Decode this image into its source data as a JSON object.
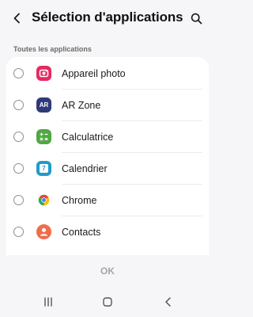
{
  "header": {
    "title": "Sélection d'applications",
    "back_icon": "back-arrow-icon",
    "search_icon": "search-icon"
  },
  "section": {
    "label": "Toutes les applications"
  },
  "apps": [
    {
      "name": "Appareil photo",
      "icon": "camera-icon",
      "color": "#e52961",
      "selected": false
    },
    {
      "name": "AR Zone",
      "icon": "ar-zone-icon",
      "color": "#2f3a7a",
      "selected": false
    },
    {
      "name": "Calculatrice",
      "icon": "calculator-icon",
      "color": "#4fa844",
      "selected": false
    },
    {
      "name": "Calendrier",
      "icon": "calendar-icon",
      "color": "#1f9bc9",
      "selected": false
    },
    {
      "name": "Chrome",
      "icon": "chrome-icon",
      "color": "#ffffff",
      "selected": false
    },
    {
      "name": "Contacts",
      "icon": "contacts-icon",
      "color": "#f06c4a",
      "selected": false
    }
  ],
  "icon_text": {
    "ar": "AR",
    "calendar": "7"
  },
  "footer": {
    "ok_label": "OK"
  },
  "navbar": {
    "recents_icon": "recents-icon",
    "home_icon": "home-icon",
    "back_icon": "nav-back-icon"
  }
}
